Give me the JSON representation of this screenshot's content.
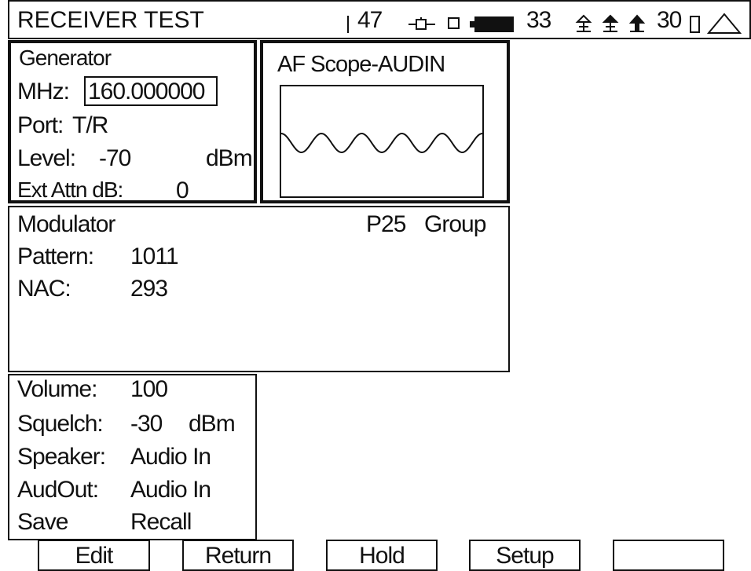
{
  "header": {
    "title": "RECEIVER TEST",
    "channel_value": "47",
    "battery_value": "33",
    "temp_value": "30"
  },
  "generator": {
    "title": "Generator",
    "freq_label": "MHz:",
    "freq_value": "160.000000",
    "port_label": "Port:",
    "port_value": "T/R",
    "level_label": "Level:",
    "level_value": "-70",
    "level_unit": "dBm",
    "ext_attn_label": "Ext Attn dB:",
    "ext_attn_value": "0"
  },
  "scope": {
    "title": "AF Scope-AUDIN"
  },
  "modulator": {
    "title": "Modulator",
    "mode": "P25",
    "mode_type": "Group",
    "pattern_label": "Pattern:",
    "pattern_value": "1011",
    "nac_label": "NAC:",
    "nac_value": "293"
  },
  "audio": {
    "volume_label": "Volume:",
    "volume_value": "100",
    "squelch_label": "Squelch:",
    "squelch_value": "-30",
    "squelch_unit": "dBm",
    "speaker_label": "Speaker:",
    "speaker_value": "Audio In",
    "audout_label": "AudOut:",
    "audout_value": "Audio In",
    "save_label": "Save",
    "recall_label": "Recall"
  },
  "softkeys": [
    "Edit",
    "Return",
    "Hold",
    "Setup",
    ""
  ]
}
